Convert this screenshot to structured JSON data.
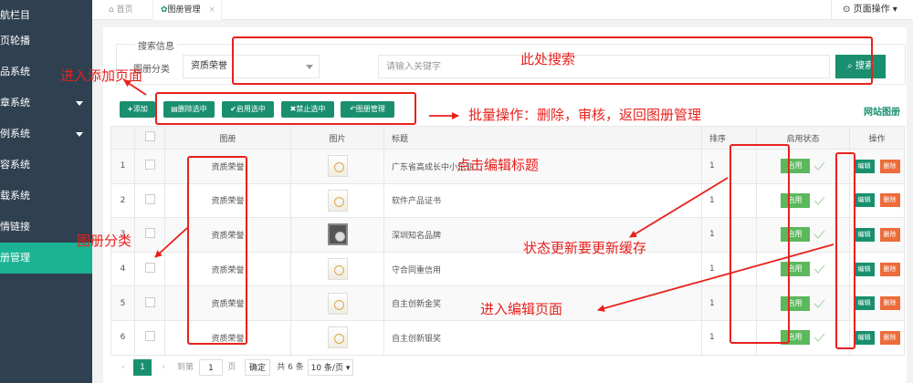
{
  "sidebar": {
    "items": [
      {
        "label": "航栏目",
        "has_arrow": false
      },
      {
        "label": "页轮播",
        "has_arrow": false
      },
      {
        "label": "品系统",
        "has_arrow": false
      },
      {
        "label": "章系统",
        "has_arrow": true
      },
      {
        "label": "例系统",
        "has_arrow": true
      },
      {
        "label": "容系统",
        "has_arrow": false
      },
      {
        "label": "载系统",
        "has_arrow": false
      },
      {
        "label": "情链接",
        "has_arrow": false
      },
      {
        "label": "册管理",
        "has_arrow": false,
        "active": true
      }
    ]
  },
  "topbar": {
    "home_tab": "首页",
    "active_tab": "图册管理",
    "close_glyph": "×",
    "page_ops": "页面操作"
  },
  "search": {
    "legend": "搜索信息",
    "category_label": "图册分类",
    "category_value": "资质荣誉",
    "keyword_placeholder": "请输入关键字",
    "button_label": "搜索"
  },
  "toolbar": {
    "add": "添加",
    "delete_selected": "删除选中",
    "enable_selected": "启用选中",
    "disable_selected": "禁止选中",
    "album_manage": "图册管理",
    "site_album": "网站图册"
  },
  "table": {
    "headers": [
      "",
      "",
      "图册",
      "图片",
      "标题",
      "排序",
      "启用状态",
      "操作"
    ],
    "rows": [
      {
        "index": "1",
        "album": "资质荣誉",
        "title": "广东省高成长中小企业",
        "sort": "1",
        "status": "启用",
        "thumb": "light"
      },
      {
        "index": "2",
        "album": "资质荣誉",
        "title": "软件产品证书",
        "sort": "1",
        "status": "启用",
        "thumb": "light"
      },
      {
        "index": "3",
        "album": "资质荣誉",
        "title": "深圳知名品牌",
        "sort": "1",
        "status": "启用",
        "thumb": "dark"
      },
      {
        "index": "4",
        "album": "资质荣誉",
        "title": "守合同重信用",
        "sort": "1",
        "status": "启用",
        "thumb": "light"
      },
      {
        "index": "5",
        "album": "资质荣誉",
        "title": "自主创新金奖",
        "sort": "1",
        "status": "启用",
        "thumb": "light"
      },
      {
        "index": "6",
        "album": "资质荣誉",
        "title": "自主创新银奖",
        "sort": "1",
        "status": "启用",
        "thumb": "light"
      }
    ],
    "edit_label": "编辑",
    "delete_label": "删除"
  },
  "pager": {
    "prev": "‹",
    "current": "1",
    "next": "›",
    "goto_label": "到第",
    "goto_value": "1",
    "page_unit": "页",
    "confirm": "确定",
    "total": "共 6 条",
    "page_size": "10 条/页"
  },
  "annotations": {
    "search_here": "此处搜索",
    "add_page": "进入添加页面",
    "batch_ops": "批量操作：删除，审核，返回图册管理",
    "edit_title": "点击编辑标题",
    "album_category": "图册分类",
    "status_cache": "状态更新要更新缓存",
    "edit_page": "进入编辑页面"
  },
  "colors": {
    "sidebar_bg": "#2f4050",
    "sidebar_active": "#1ab394",
    "primary": "#1a8f6f",
    "status_green": "#5cb85c",
    "danger": "#ec6c3a",
    "annotation_red": "#e8211d"
  }
}
